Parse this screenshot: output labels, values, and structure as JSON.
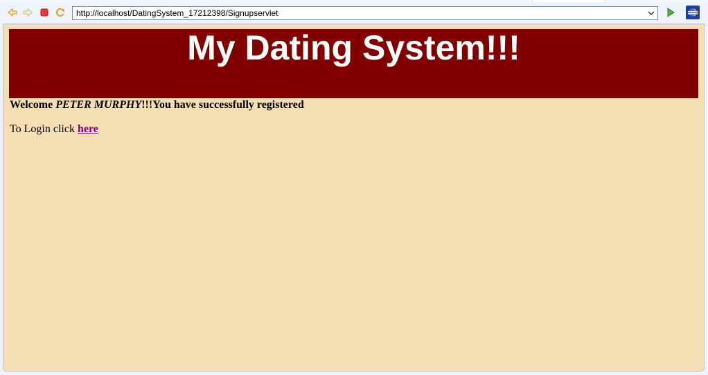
{
  "browser": {
    "url": "http://localhost/DatingSystem_17212398/Signupservlet",
    "icons": {
      "back": "back-arrow-icon",
      "forward": "forward-arrow-icon",
      "stop": "stop-icon",
      "refresh": "refresh-icon",
      "dropdown": "chevron-down-icon",
      "go": "go-arrow-icon",
      "eclipse": "eclipse-icon"
    }
  },
  "page": {
    "banner_title": "My Dating System!!!",
    "welcome_prefix": "Welcome ",
    "user_name": "PETER MURPHY",
    "welcome_suffix": "!!!You have successfully registered",
    "login_prefix": "To Login click ",
    "login_link": "here"
  },
  "colors": {
    "page_background": "#f5deb3",
    "banner_background": "#800000",
    "banner_text": "#ffffff",
    "link": "#800080"
  }
}
